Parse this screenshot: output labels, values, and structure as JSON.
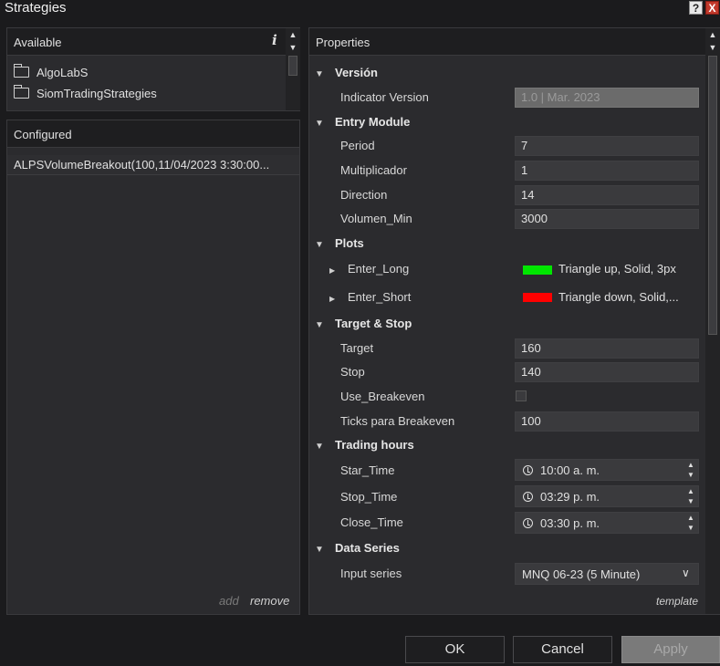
{
  "window": {
    "title": "Strategies",
    "help_label": "?",
    "close_label": "X"
  },
  "available": {
    "header": "Available",
    "items": [
      {
        "label": "AlgoLabS",
        "icon": "folder-icon"
      },
      {
        "label": "SiomTradingStrategies",
        "icon": "folder-icon"
      }
    ]
  },
  "configured": {
    "header": "Configured",
    "items": [
      {
        "label": "ALPSVolumeBreakout(100,11/04/2023 3:30:00..."
      }
    ],
    "add_label": "add",
    "remove_label": "remove"
  },
  "properties": {
    "header": "Properties",
    "categories": {
      "version": {
        "label": "Versión",
        "rows": [
          {
            "label": "Indicator Version",
            "value": "1.0 | Mar. 2023"
          }
        ]
      },
      "entry": {
        "label": "Entry Module",
        "rows": [
          {
            "label": "Period",
            "value": "7"
          },
          {
            "label": "Multiplicador",
            "value": "1"
          },
          {
            "label": "Direction",
            "value": "14"
          },
          {
            "label": "Volumen_Min",
            "value": "3000"
          }
        ]
      },
      "plots": {
        "label": "Plots",
        "rows": [
          {
            "label": "Enter_Long",
            "value": "Triangle up, Solid, 3px",
            "color": "#00e600"
          },
          {
            "label": "Enter_Short",
            "value": "Triangle down, Solid,...",
            "color": "#ff0000"
          }
        ]
      },
      "target": {
        "label": "Target & Stop",
        "rows": [
          {
            "label": "Target",
            "value": "160"
          },
          {
            "label": "Stop",
            "value": "140"
          },
          {
            "label": "Use_Breakeven",
            "value": false
          },
          {
            "label": "Ticks para Breakeven",
            "value": "100"
          }
        ]
      },
      "hours": {
        "label": "Trading hours",
        "rows": [
          {
            "label": "Star_Time",
            "value": "10:00 a. m."
          },
          {
            "label": "Stop_Time",
            "value": "03:29 p. m."
          },
          {
            "label": "Close_Time",
            "value": "03:30 p. m."
          }
        ]
      },
      "series": {
        "label": "Data Series",
        "rows": [
          {
            "label": "Input series",
            "value": "MNQ 06-23 (5 Minute)"
          }
        ]
      }
    },
    "template_label": "template"
  },
  "buttons": {
    "ok": "OK",
    "cancel": "Cancel",
    "apply": "Apply"
  },
  "colors": {
    "background": "#1b1b1d",
    "panel": "#2b2b2e",
    "header": "#1e1e20",
    "field": "#3a3a3d",
    "long_plot": "#00e600",
    "short_plot": "#ff0000"
  }
}
